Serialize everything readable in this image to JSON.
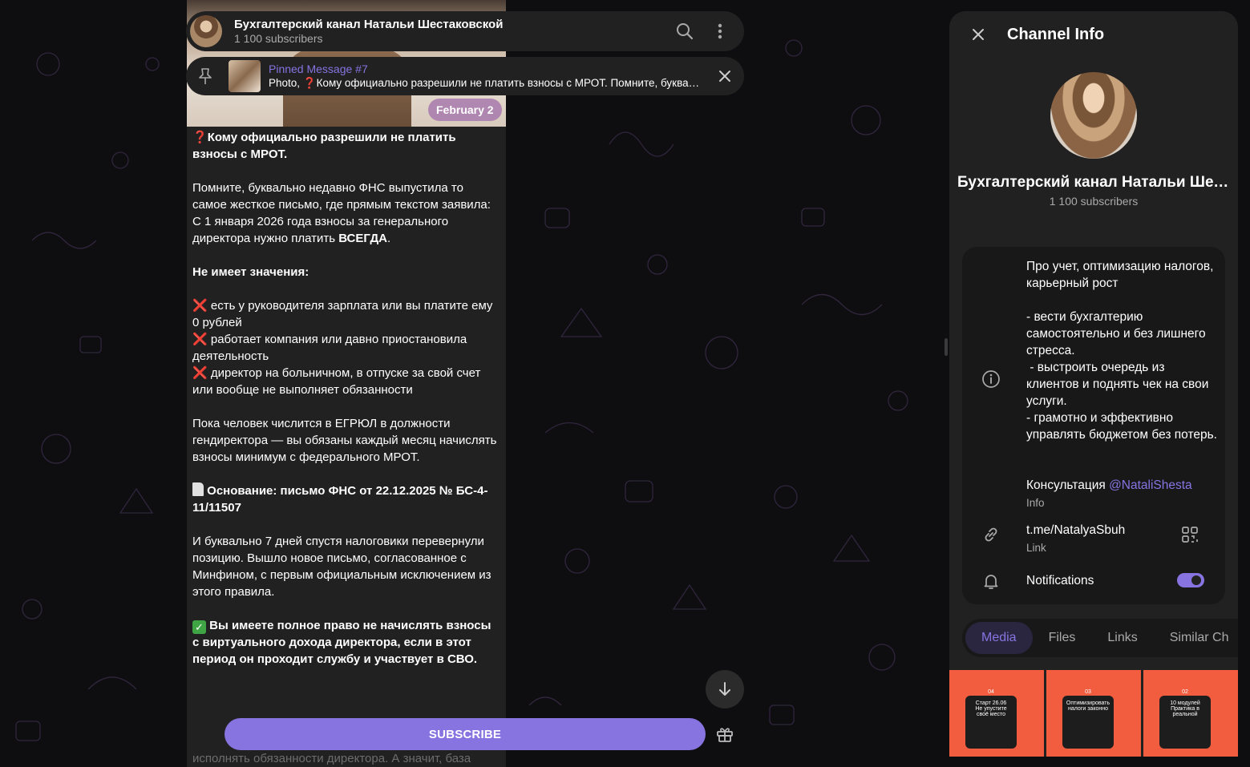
{
  "chat": {
    "title": "Бухгалтерский канал Натальи Шестаковской",
    "subscribers": "1 100 subscribers"
  },
  "pinned": {
    "title": "Pinned Message #7",
    "prefix": "Photo, ",
    "mark": "❓",
    "text": "Кому официально разрешили не платить взносы с МРОТ. Помните, буквально недавно ФНС выпустила то самое"
  },
  "message": {
    "date": "February 2",
    "headline_mark": "❓",
    "headline": "Кому официально разрешили не платить взносы с МРОТ.",
    "p1": "Помните, буквально недавно ФНС выпустила то самое жесткое письмо, где прямым текстом заявила:",
    "p2_start": "С 1 января 2026 года взносы за генерального директора нужно платить ",
    "p2_bold": "ВСЕГДА",
    "p2_end": ".",
    "p3": "Не имеет значения:",
    "items": [
      "есть у руководителя зарплата или вы платите ему 0 рублей",
      "работает компания или давно приостановила деятельность",
      "директор на больничном, в отпуске за свой счет или вообще не выполняет обязанности"
    ],
    "x_mark": "❌",
    "p4": "Пока человек числится в ЕГРЮЛ в должности гендиректора — вы обязаны каждый месяц начислять взносы минимум с федерального МРОТ.",
    "basis": "Основание: письмо ФНС от 22.12.2025 № БС-4-11/11507",
    "p5": "И буквально 7 дней спустя налоговики перевернули позицию. Вышло новое письмо, согласованное с Минфином, с первым официальным исключением из этого правила.",
    "ok_mark": "✓",
    "p6": "Вы имеете полное право не начислять взносы с виртуального дохода директора, если в этот период он проходит службу и участвует в СВО.",
    "cut": "исполнять обязанности директора. А значит, база"
  },
  "bottom": {
    "subscribe": "SUBSCRIBE"
  },
  "panel": {
    "title": "Channel Info",
    "name": "Бухгалтерский канал Натальи Шестаковской",
    "subscribers": "1 100 subscribers",
    "about": [
      "Про учет, оптимизацию налогов, карьерный рост",
      "",
      "- вести бухгалтерию самостоятельно и без лишнего стресса.",
      " - выстроить очередь из клиентов и поднять чек на свои услуги.",
      "- грамотно и эффективно управлять бюджетом без потерь."
    ],
    "consult_label": "Консультация ",
    "consult_handle": "@NataliShesta",
    "consult_caption": "Info",
    "link": "t.me/NatalyaSbuh",
    "link_caption": "Link",
    "notifications": "Notifications",
    "notifications_on": true,
    "tabs": [
      "Media",
      "Files",
      "Links",
      "Similar Ch"
    ],
    "media": [
      {
        "num": "04",
        "tag": "Старт 26.06",
        "text": "Не упустите своё место"
      },
      {
        "num": "03",
        "tag": "Оптимизировать налоги законно",
        "text": ""
      },
      {
        "num": "02",
        "tag": "10 модулей",
        "text": "Практика в реальной"
      }
    ]
  },
  "colors": {
    "accent": "#8774e1",
    "panel": "#212121",
    "card": "#181818",
    "danger": "#e53935",
    "ok": "#3fa544"
  }
}
